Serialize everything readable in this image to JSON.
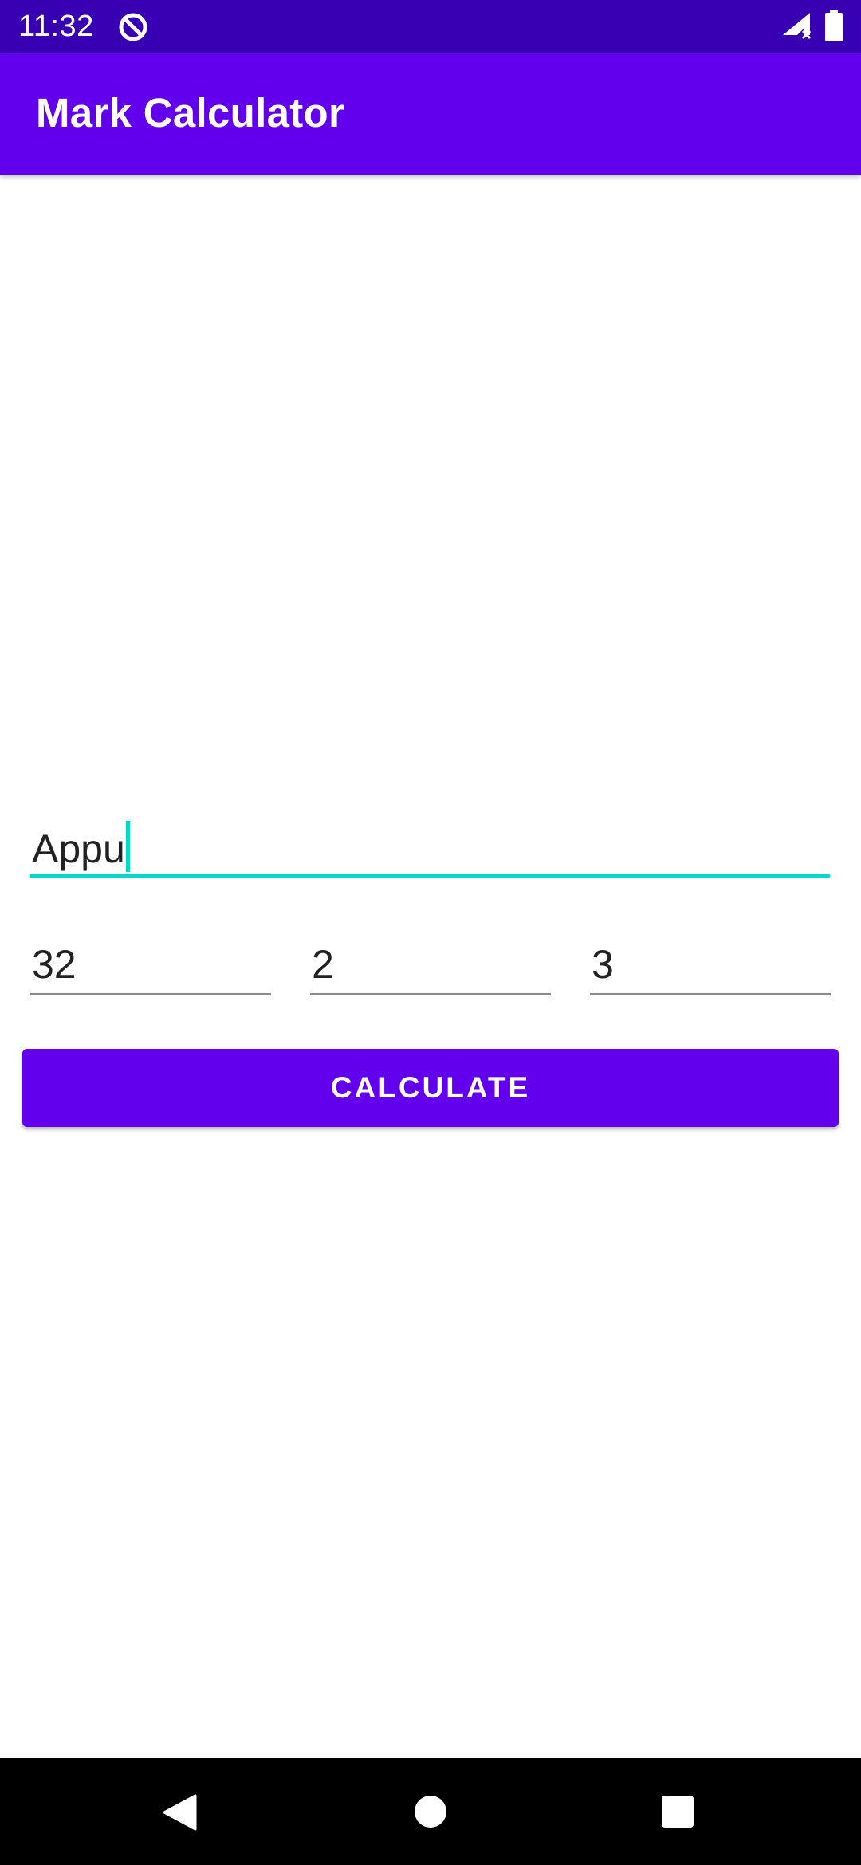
{
  "status_bar": {
    "time": "11:32",
    "icons": [
      "app-notification-icon",
      "signal-icon",
      "battery-icon"
    ]
  },
  "app_bar": {
    "title": "Mark Calculator"
  },
  "form": {
    "name_value": "Appu",
    "marks": [
      "32",
      "2",
      "3"
    ],
    "calculate_label": "CALCULATE"
  },
  "nav_bar": {
    "icons": [
      "back-icon",
      "home-icon",
      "recents-icon"
    ]
  },
  "colors": {
    "status_bar": "#3700b3",
    "primary": "#6200ee",
    "accent": "#03dac5",
    "nav_bar": "#000000"
  }
}
